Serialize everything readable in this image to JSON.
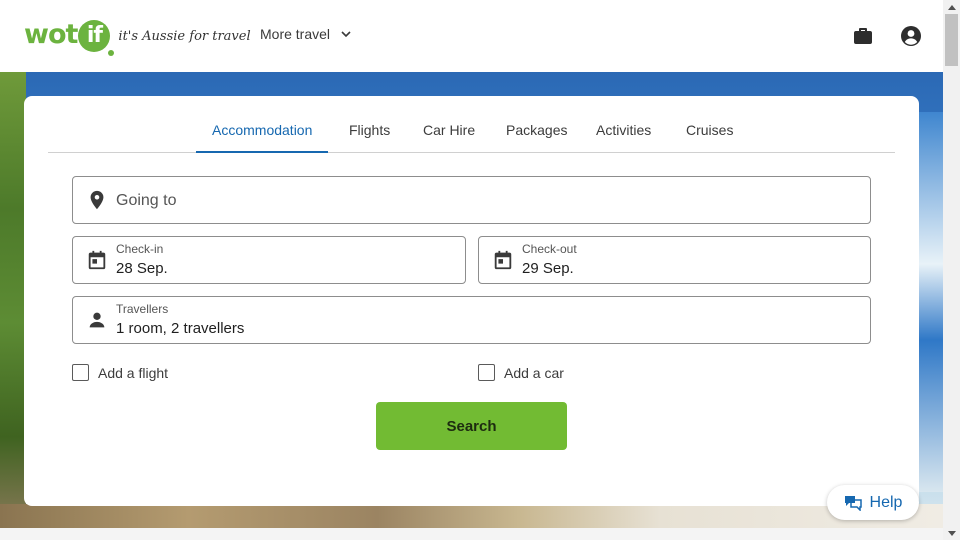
{
  "header": {
    "logo_word": "wot",
    "logo_if": "if",
    "logo_tagline": "it's Aussie for travel",
    "more_travel_label": "More travel",
    "icons": {
      "trips": "briefcase-icon",
      "account": "account-circle-icon"
    }
  },
  "tabs": [
    {
      "label": "Accommodation",
      "active": true
    },
    {
      "label": "Flights",
      "active": false
    },
    {
      "label": "Car Hire",
      "active": false
    },
    {
      "label": "Packages",
      "active": false
    },
    {
      "label": "Activities",
      "active": false
    },
    {
      "label": "Cruises",
      "active": false
    }
  ],
  "form": {
    "destination": {
      "placeholder": "Going to",
      "icon": "location-pin-icon"
    },
    "checkin": {
      "label": "Check-in",
      "value": "28 Sep.",
      "icon": "calendar-icon"
    },
    "checkout": {
      "label": "Check-out",
      "value": "29 Sep.",
      "icon": "calendar-icon"
    },
    "travellers": {
      "label": "Travellers",
      "value": "1 room, 2 travellers",
      "icon": "person-icon"
    },
    "add_flight": {
      "label": "Add a flight",
      "checked": false
    },
    "add_car": {
      "label": "Add a car",
      "checked": false
    },
    "search_label": "Search"
  },
  "help": {
    "label": "Help",
    "icon": "chat-bubbles-icon"
  },
  "colors": {
    "brand_green": "#6cb33f",
    "search_green": "#72bb33",
    "link_blue": "#1668b0"
  }
}
